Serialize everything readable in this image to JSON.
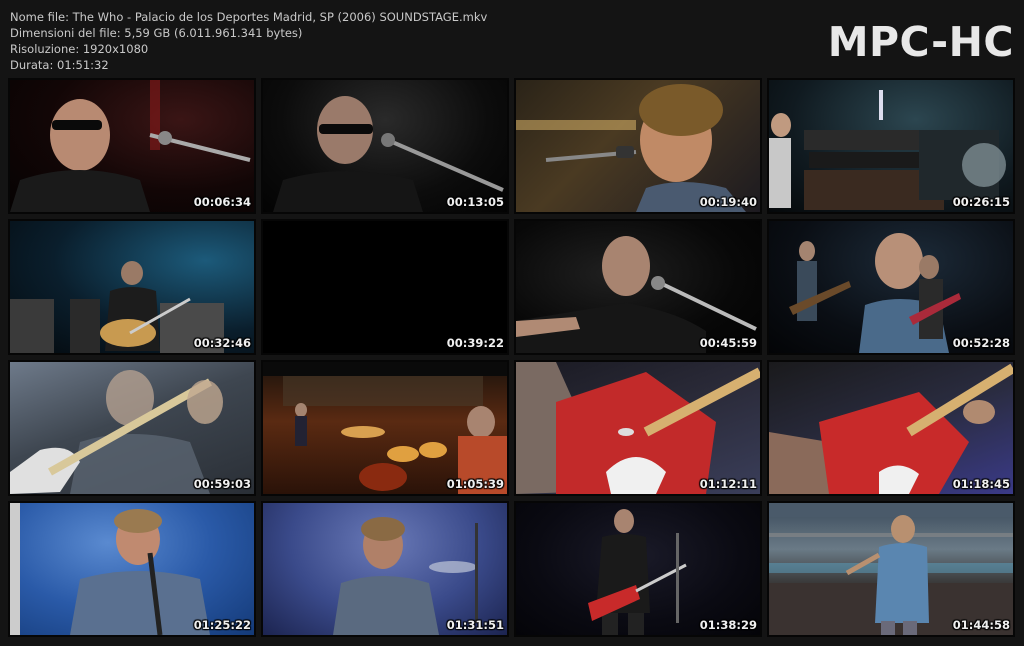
{
  "info": {
    "line1": "Nome file: The Who - Palacio de los Deportes Madrid, SP (2006) SOUNDSTAGE.mkv",
    "line2": "Dimensioni del file: 5,59 GB (6.011.961.341 bytes)",
    "line3": "Risoluzione: 1920x1080",
    "line4": "Durata: 01:51:32"
  },
  "logo": "MPC-HC",
  "thumbnails": [
    {
      "time": "00:06:34",
      "scene": "guitarist-sunglasses-microphone"
    },
    {
      "time": "00:13:05",
      "scene": "guitarist-sunglasses-microphone"
    },
    {
      "time": "00:19:40",
      "scene": "singer-glasses-microphone"
    },
    {
      "time": "00:26:15",
      "scene": "keyboard-rig"
    },
    {
      "time": "00:32:46",
      "scene": "acoustic-guitarist-amps"
    },
    {
      "time": "00:39:22",
      "scene": "black-frame"
    },
    {
      "time": "00:45:59",
      "scene": "guitarist-microphone-closeup"
    },
    {
      "time": "00:52:28",
      "scene": "singer-and-guitarist"
    },
    {
      "time": "00:59:03",
      "scene": "singer-with-guitar-washed"
    },
    {
      "time": "01:05:39",
      "scene": "drummer-arena-crowd"
    },
    {
      "time": "01:12:11",
      "scene": "red-guitar-closeup"
    },
    {
      "time": "01:18:45",
      "scene": "red-guitar-closeup"
    },
    {
      "time": "01:25:22",
      "scene": "singer-blue-light"
    },
    {
      "time": "01:31:51",
      "scene": "singer-blue-light"
    },
    {
      "time": "01:38:29",
      "scene": "guitarist-red-guitar-stage"
    },
    {
      "time": "01:44:58",
      "scene": "singer-arena-crowd"
    }
  ]
}
